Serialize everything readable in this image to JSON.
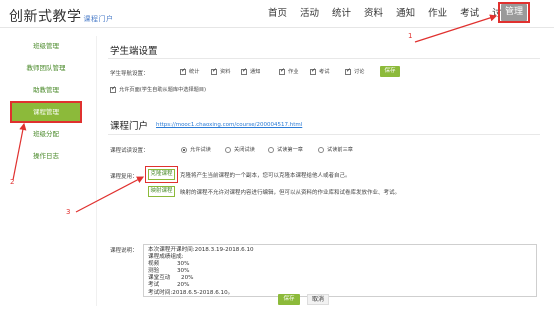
{
  "header": {
    "logo_title": "创新式教学",
    "logo_subtitle": "课程门户",
    "nav": [
      "首页",
      "活动",
      "统计",
      "资料",
      "通知",
      "作业",
      "考试",
      "讨论"
    ],
    "nav_active": "管理"
  },
  "sidebar": {
    "items": [
      "班级管理",
      "教师团队管理",
      "助教管理",
      "课程管理",
      "班级分配",
      "操作日志"
    ],
    "active_index": 3
  },
  "student_settings": {
    "title": "学生端设置",
    "module_label": "学生导航设置：",
    "modules": [
      "统计",
      "资料",
      "通知",
      "作业",
      "考试",
      "讨论"
    ],
    "save_label": "保存",
    "allow_label": "允许页面(学生自助从题库中选择题目)"
  },
  "course_portal": {
    "title": "课程门户",
    "url": "https://mooc1.chaoxing.com/course/200004517.html",
    "trial_label": "课程试读设置：",
    "trial_options": [
      "允许试读",
      "关闭试读",
      "试读第一章",
      "试读前三章"
    ],
    "trial_selected": 0,
    "reuse_label": "课程复用：",
    "clone_button": "克隆课程",
    "clone_desc": "克隆将产生当前课程的一个副本，您可以克隆本课程给他人或者自己。",
    "map_button": "映射课程",
    "map_desc": "映射的课程不允许对课程内容进行编辑，但可以从资料的作业库和试卷库发放作业、考试。",
    "intro_label": "课程说明：",
    "intro_lines": [
      "本次课程开课时间:2018.3.19-2018.6.10",
      "课程成绩组成:",
      "视频          30%",
      "测验          30%",
      "课堂互动      20%",
      "考试          20%",
      "考试时间:2018.6.5-2018.6.10。"
    ],
    "save_label": "保存",
    "cancel_label": "取消"
  },
  "annotations": [
    "1",
    "2",
    "3"
  ],
  "colors": {
    "accent_green": "#8cba3a",
    "annotation_red": "#e0312f",
    "link_blue": "#2a7bd6"
  }
}
